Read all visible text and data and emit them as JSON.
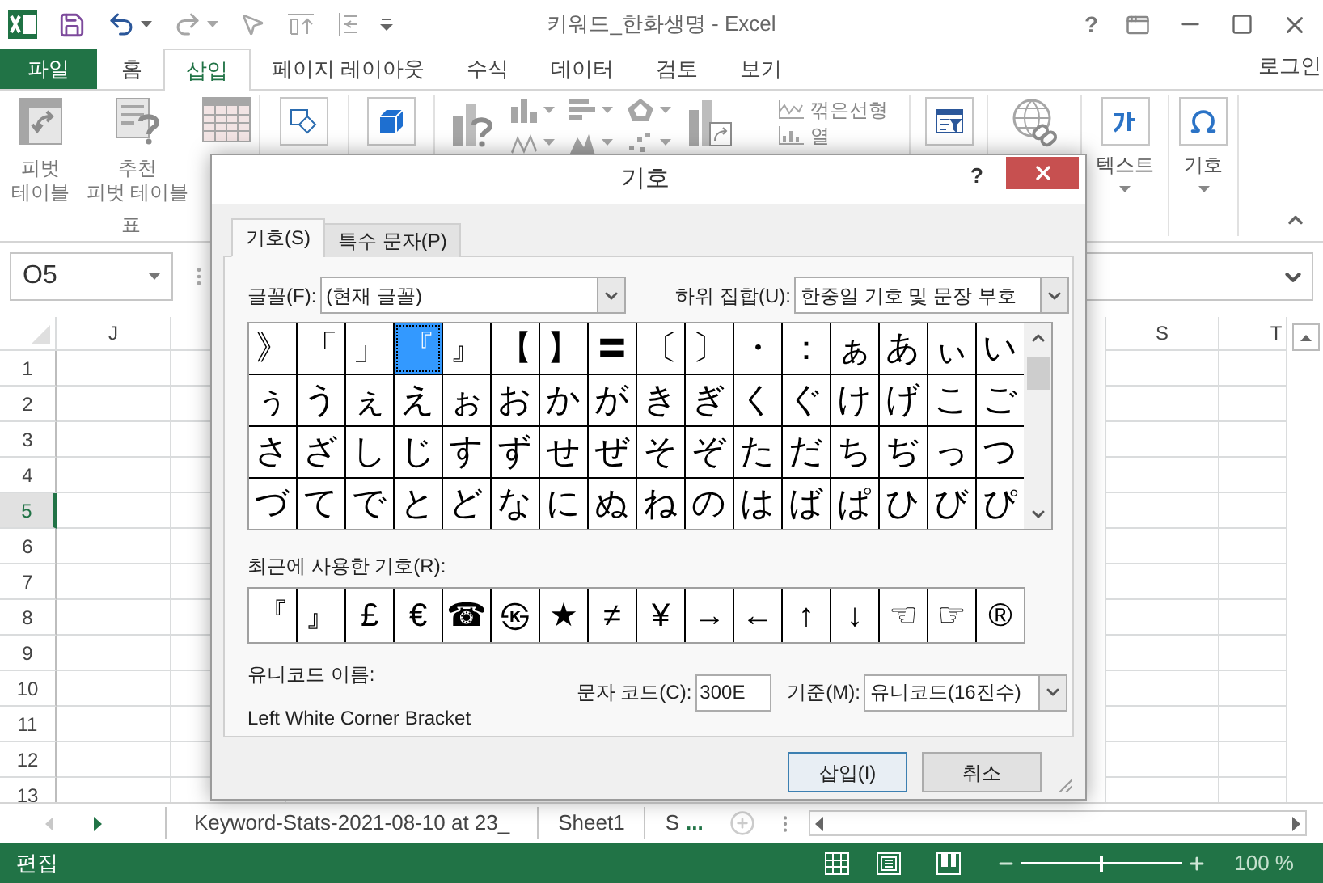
{
  "window": {
    "title": "키워드_한화생명 - Excel",
    "help": "?"
  },
  "ribbon": {
    "tabs": [
      {
        "label": "파일",
        "kind": "file",
        "selected": false
      },
      {
        "label": "홈",
        "kind": "tab",
        "selected": false
      },
      {
        "label": "삽입",
        "kind": "tab",
        "selected": true
      },
      {
        "label": "페이지 레이아웃",
        "kind": "tab",
        "selected": false
      },
      {
        "label": "수식",
        "kind": "tab",
        "selected": false
      },
      {
        "label": "데이터",
        "kind": "tab",
        "selected": false
      },
      {
        "label": "검토",
        "kind": "tab",
        "selected": false
      },
      {
        "label": "보기",
        "kind": "tab",
        "selected": false
      }
    ],
    "account": "로그인",
    "pivot_table": [
      "피벗",
      "테이블"
    ],
    "recommended_pivot": [
      "추천",
      "피벗 테이블"
    ],
    "tables_group": "표",
    "line_sparkline": "꺾은선형",
    "column_sparkline": "열",
    "text": "텍스트",
    "symbol": "기호"
  },
  "name_box": "O5",
  "sheet": {
    "columns": [
      "J",
      "S",
      "T"
    ],
    "rows": [
      {
        "label": "1",
        "selected": false
      },
      {
        "label": "2",
        "selected": false
      },
      {
        "label": "3",
        "selected": false
      },
      {
        "label": "4",
        "selected": false
      },
      {
        "label": "5",
        "selected": true
      },
      {
        "label": "6",
        "selected": false
      },
      {
        "label": "7",
        "selected": false
      },
      {
        "label": "8",
        "selected": false
      },
      {
        "label": "9",
        "selected": false
      },
      {
        "label": "10",
        "selected": false
      },
      {
        "label": "11",
        "selected": false
      },
      {
        "label": "12",
        "selected": false
      },
      {
        "label": "13",
        "selected": false
      }
    ]
  },
  "sheet_tabs": [
    "Keyword-Stats-2021-08-10 at 23_",
    "Sheet1",
    "S"
  ],
  "more_tabs": "...",
  "status_bar": {
    "mode": "편집",
    "zoom_slider": {
      "level": 0.5
    },
    "zoom": "100 %"
  },
  "dialog": {
    "title": "기호",
    "help": "?",
    "tabs": [
      {
        "label": "기호(S)",
        "selected": true
      },
      {
        "label": "특수 문자(P)",
        "selected": false
      }
    ],
    "font_label": "글꼴(F):",
    "font_value": "(현재 글꼴)",
    "subset_label": "하위 집합(U):",
    "subset_value": "한중일 기호 및 문장 부호",
    "symbols": [
      {
        "char": "》",
        "selected": false
      },
      {
        "char": "「",
        "selected": false
      },
      {
        "char": "」",
        "selected": false
      },
      {
        "char": "『",
        "selected": true
      },
      {
        "char": "』",
        "selected": false
      },
      {
        "char": "【",
        "selected": false
      },
      {
        "char": "】",
        "selected": false
      },
      {
        "char": "〓",
        "selected": false
      },
      {
        "char": "〔",
        "selected": false
      },
      {
        "char": "〕",
        "selected": false
      },
      {
        "char": "・",
        "selected": false
      },
      {
        "char": "：",
        "selected": false
      },
      {
        "char": "ぁ",
        "selected": false
      },
      {
        "char": "あ",
        "selected": false
      },
      {
        "char": "ぃ",
        "selected": false
      },
      {
        "char": "い",
        "selected": false
      },
      {
        "char": "ぅ",
        "selected": false
      },
      {
        "char": "う",
        "selected": false
      },
      {
        "char": "ぇ",
        "selected": false
      },
      {
        "char": "え",
        "selected": false
      },
      {
        "char": "ぉ",
        "selected": false
      },
      {
        "char": "お",
        "selected": false
      },
      {
        "char": "か",
        "selected": false
      },
      {
        "char": "が",
        "selected": false
      },
      {
        "char": "き",
        "selected": false
      },
      {
        "char": "ぎ",
        "selected": false
      },
      {
        "char": "く",
        "selected": false
      },
      {
        "char": "ぐ",
        "selected": false
      },
      {
        "char": "け",
        "selected": false
      },
      {
        "char": "げ",
        "selected": false
      },
      {
        "char": "こ",
        "selected": false
      },
      {
        "char": "ご",
        "selected": false
      },
      {
        "char": "さ",
        "selected": false
      },
      {
        "char": "ざ",
        "selected": false
      },
      {
        "char": "し",
        "selected": false
      },
      {
        "char": "じ",
        "selected": false
      },
      {
        "char": "す",
        "selected": false
      },
      {
        "char": "ず",
        "selected": false
      },
      {
        "char": "せ",
        "selected": false
      },
      {
        "char": "ぜ",
        "selected": false
      },
      {
        "char": "そ",
        "selected": false
      },
      {
        "char": "ぞ",
        "selected": false
      },
      {
        "char": "た",
        "selected": false
      },
      {
        "char": "だ",
        "selected": false
      },
      {
        "char": "ち",
        "selected": false
      },
      {
        "char": "ぢ",
        "selected": false
      },
      {
        "char": "っ",
        "selected": false
      },
      {
        "char": "つ",
        "selected": false
      },
      {
        "char": "づ",
        "selected": false
      },
      {
        "char": "て",
        "selected": false
      },
      {
        "char": "で",
        "selected": false
      },
      {
        "char": "と",
        "selected": false
      },
      {
        "char": "ど",
        "selected": false
      },
      {
        "char": "な",
        "selected": false
      },
      {
        "char": "に",
        "selected": false
      },
      {
        "char": "ぬ",
        "selected": false
      },
      {
        "char": "ね",
        "selected": false
      },
      {
        "char": "の",
        "selected": false
      },
      {
        "char": "は",
        "selected": false
      },
      {
        "char": "ば",
        "selected": false
      },
      {
        "char": "ぱ",
        "selected": false
      },
      {
        "char": "ひ",
        "selected": false
      },
      {
        "char": "び",
        "selected": false
      },
      {
        "char": "ぴ",
        "selected": false
      }
    ],
    "recent_label": "최근에 사용한 기호(R):",
    "recent": [
      "『",
      "』",
      "£",
      "€",
      "☎",
      "㉿",
      "★",
      "≠",
      "¥",
      "→",
      "←",
      "↑",
      "↓",
      "☜",
      "☞",
      "®"
    ],
    "unicode_name_label": "유니코드 이름:",
    "unicode_name": "Left White Corner Bracket",
    "char_code_label": "문자 코드(C):",
    "char_code": "300E",
    "from_label": "기준(M):",
    "from_value": "유니코드(16진수)",
    "buttons": [
      {
        "label": "삽입(I)",
        "kind": "default"
      },
      {
        "label": "취소",
        "kind": "normal"
      }
    ]
  }
}
